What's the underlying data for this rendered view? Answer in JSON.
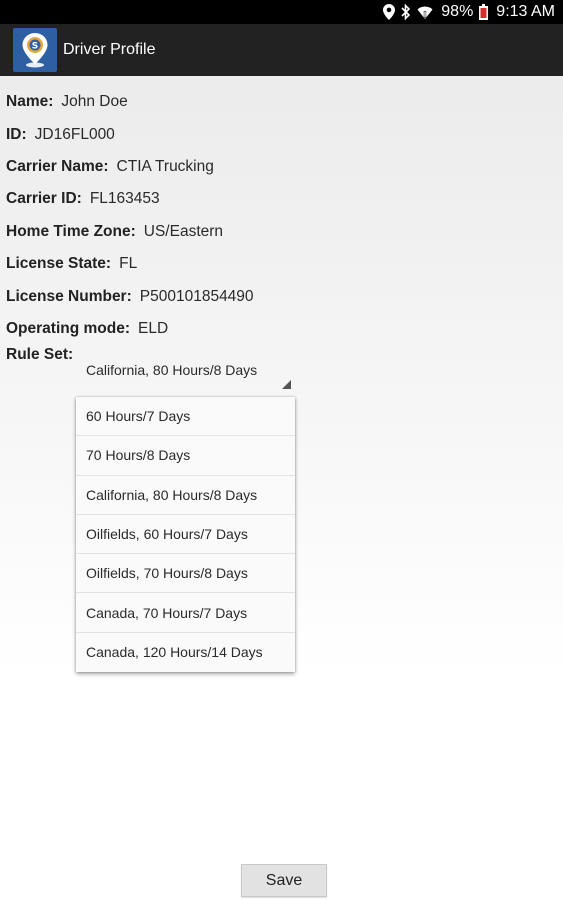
{
  "status_bar": {
    "icons": [
      "location-icon",
      "bluetooth-icon",
      "wifi-icon",
      "battery-icon"
    ],
    "battery_percent": "98%",
    "time": "9:13 AM"
  },
  "action_bar": {
    "app_icon": "app-location-pin-icon",
    "title": "Driver Profile"
  },
  "profile": {
    "fields": [
      {
        "label": "Name:",
        "value": "John Doe"
      },
      {
        "label": "ID:",
        "value": "JD16FL000"
      },
      {
        "label": "Carrier Name:",
        "value": "CTIA Trucking"
      },
      {
        "label": "Carrier ID:",
        "value": "FL163453"
      },
      {
        "label": "Home Time Zone:",
        "value": "US/Eastern"
      },
      {
        "label": "License State:",
        "value": "FL"
      },
      {
        "label": "License Number:",
        "value": "P500101854490"
      },
      {
        "label": "Operating mode:",
        "value": "ELD"
      }
    ],
    "rule_set": {
      "label": "Rule Set:",
      "selected": "California, 80 Hours/8 Days",
      "options": [
        "60 Hours/7 Days",
        "70 Hours/8 Days",
        "California, 80 Hours/8 Days",
        "Oilfields, 60 Hours/7 Days",
        "Oilfields, 70 Hours/8 Days",
        "Canada, 70 Hours/7 Days",
        "Canada, 120 Hours/14 Days"
      ]
    }
  },
  "actions": {
    "save_label": "Save"
  },
  "colors": {
    "status_bar": "#000000",
    "action_bar": "#222222",
    "app_icon_bg": "#2f5fa3"
  }
}
